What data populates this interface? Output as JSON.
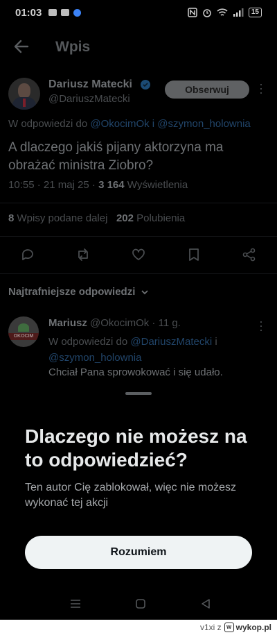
{
  "status_bar": {
    "time": "01:03",
    "battery": "15"
  },
  "header": {
    "title": "Wpis"
  },
  "tweet": {
    "author_name": "Dariusz Matecki",
    "author_handle": "@DariuszMatecki",
    "follow_label": "Obserwuj",
    "reply_to_prefix": "W odpowiedzi do",
    "reply_to_handles": "@OkocimOk i @szymon_holownia",
    "text": "A dlaczego jakiś pijany aktorzyna ma obrażać ministra Ziobro?",
    "time_date": "10:55 · 21 maj 25 · ",
    "views_count": "3 164",
    "views_label": " Wyświetlenia",
    "reposts_count": "8",
    "reposts_label": " Wpisy podane dalej",
    "likes_count": "202",
    "likes_label": " Polubienia"
  },
  "replies": {
    "sort_label": "Najtrafniejsze odpowiedzi",
    "items": [
      {
        "name": "Mariusz",
        "handle_time": " @OkocimOk · 11 g.",
        "reply_prefix": "W odpowiedzi do ",
        "reply_handle1": "@DariuszMatecki",
        "reply_joiner": " i ",
        "reply_handle2": "@szymon_holownia",
        "text": "Chciał Pana sprowokować i się udało.",
        "avatar_text": "OKOCIM"
      }
    ]
  },
  "sheet": {
    "title": "Dlaczego nie możesz na to odpowiedzieć?",
    "description": "Ten autor Cię zablokował, więc nie możesz wykonać tej akcji",
    "button_label": "Rozumiem"
  },
  "footer": {
    "user": "v1xi z",
    "site": "wykop.pl"
  },
  "icons": {
    "back": "back-arrow-icon",
    "verified": "verified-badge-icon",
    "reply": "reply-icon",
    "repost": "repost-icon",
    "like": "heart-icon",
    "bookmark": "bookmark-icon",
    "share": "share-icon"
  },
  "colors": {
    "background": "#000000",
    "button_bg": "#eff3f4",
    "link_dim": "#21456a"
  }
}
